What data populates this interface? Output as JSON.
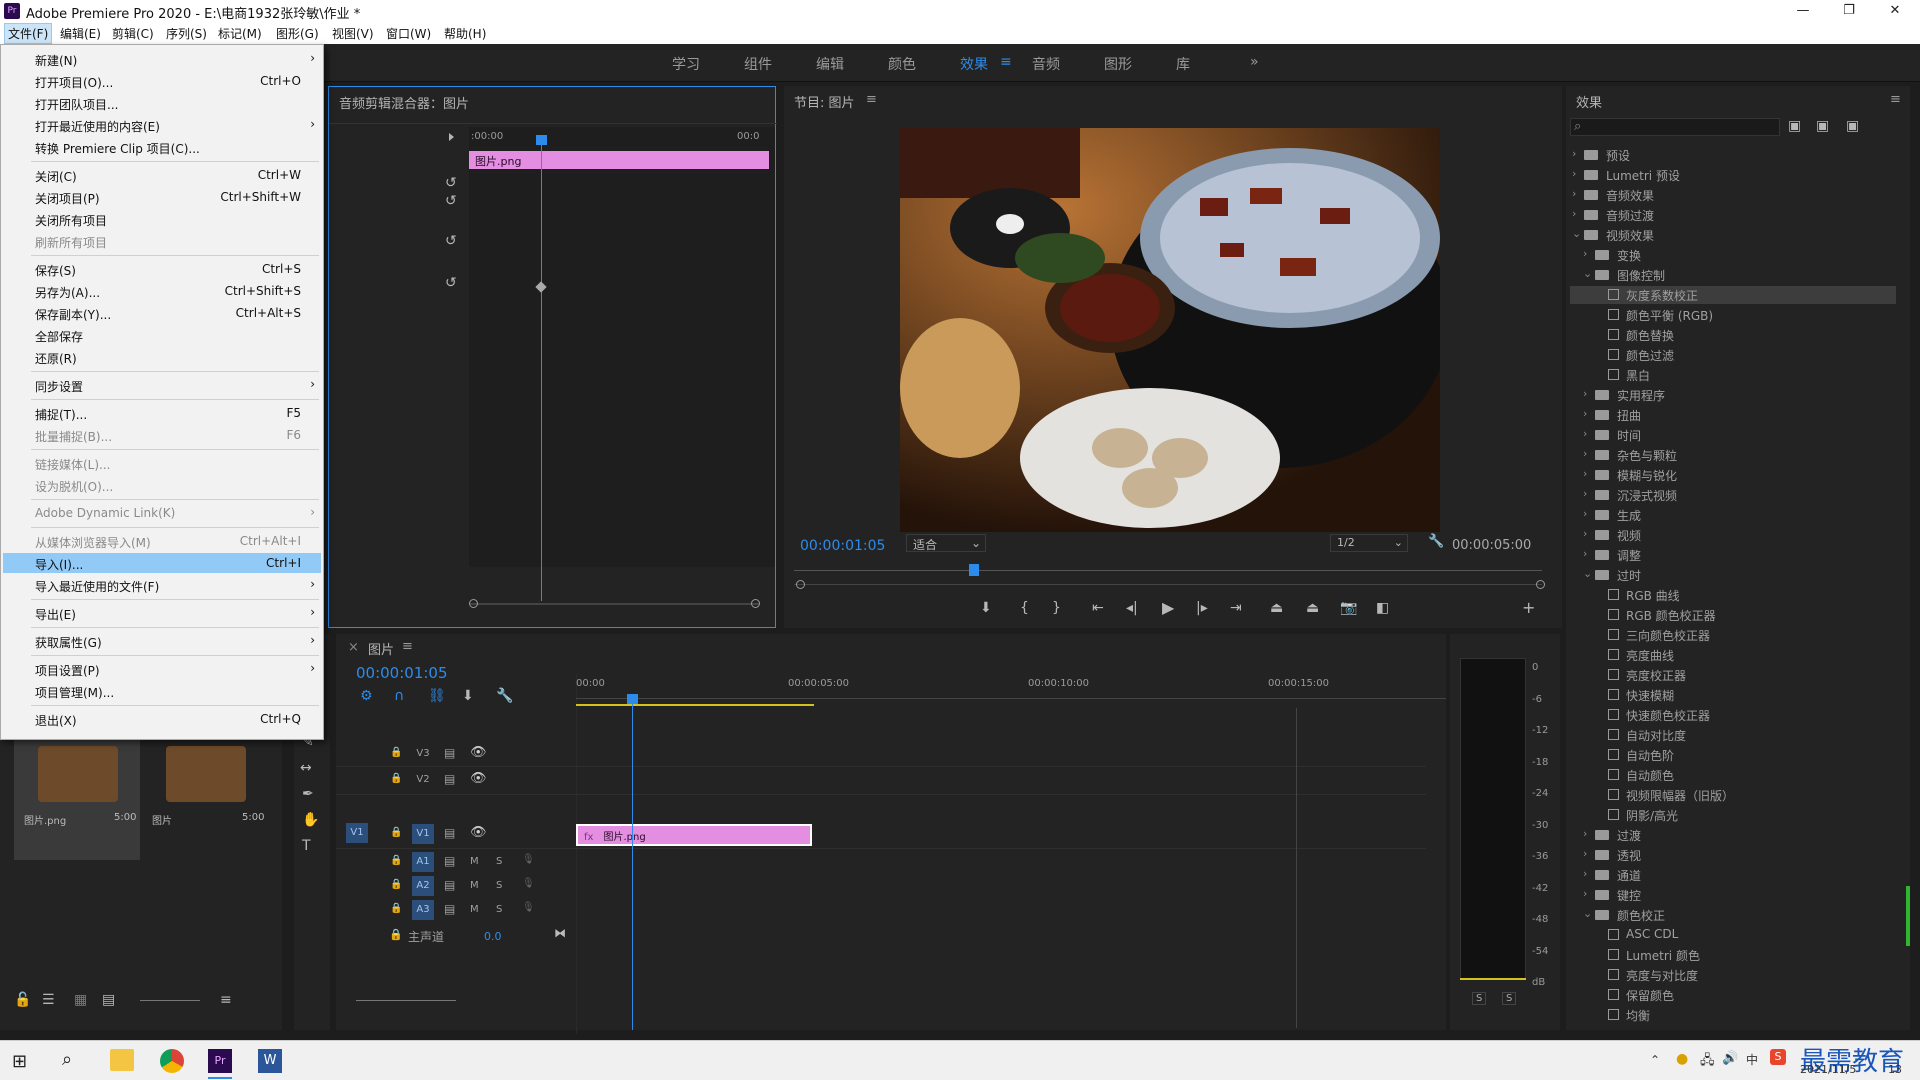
{
  "app": {
    "title": "Adobe Premiere Pro 2020 - E:\\电商1932张玲敏\\作业 *",
    "icon_label": "Pr"
  },
  "menubar": [
    "文件(F)",
    "编辑(E)",
    "剪辑(C)",
    "序列(S)",
    "标记(M)",
    "图形(G)",
    "视图(V)",
    "窗口(W)",
    "帮助(H)"
  ],
  "workspaces": [
    "学习",
    "组件",
    "编辑",
    "颜色",
    "效果",
    "音频",
    "图形",
    "库"
  ],
  "workspace_active": "效果",
  "workspace_more": "»",
  "file_menu": [
    {
      "label": "新建(N)",
      "shortcut": "",
      "arrow": true,
      "disabled": false
    },
    {
      "label": "打开项目(O)...",
      "shortcut": "Ctrl+O",
      "arrow": false,
      "disabled": false
    },
    {
      "label": "打开团队项目...",
      "shortcut": "",
      "arrow": false,
      "disabled": false
    },
    {
      "label": "打开最近使用的内容(E)",
      "shortcut": "",
      "arrow": true,
      "disabled": false
    },
    {
      "label": "转换 Premiere Clip 项目(C)...",
      "shortcut": "",
      "arrow": false,
      "disabled": false
    },
    {
      "label": "关闭(C)",
      "shortcut": "Ctrl+W",
      "arrow": false,
      "disabled": false
    },
    {
      "label": "关闭项目(P)",
      "shortcut": "Ctrl+Shift+W",
      "arrow": false,
      "disabled": false
    },
    {
      "label": "关闭所有项目",
      "shortcut": "",
      "arrow": false,
      "disabled": false
    },
    {
      "label": "刷新所有项目",
      "shortcut": "",
      "arrow": false,
      "disabled": true
    },
    {
      "label": "保存(S)",
      "shortcut": "Ctrl+S",
      "arrow": false,
      "disabled": false
    },
    {
      "label": "另存为(A)...",
      "shortcut": "Ctrl+Shift+S",
      "arrow": false,
      "disabled": false
    },
    {
      "label": "保存副本(Y)...",
      "shortcut": "Ctrl+Alt+S",
      "arrow": false,
      "disabled": false
    },
    {
      "label": "全部保存",
      "shortcut": "",
      "arrow": false,
      "disabled": false
    },
    {
      "label": "还原(R)",
      "shortcut": "",
      "arrow": false,
      "disabled": false
    },
    {
      "label": "同步设置",
      "shortcut": "",
      "arrow": true,
      "disabled": false
    },
    {
      "label": "捕捉(T)...",
      "shortcut": "F5",
      "arrow": false,
      "disabled": false
    },
    {
      "label": "批量捕捉(B)...",
      "shortcut": "F6",
      "arrow": false,
      "disabled": true
    },
    {
      "label": "链接媒体(L)...",
      "shortcut": "",
      "arrow": false,
      "disabled": true
    },
    {
      "label": "设为脱机(O)...",
      "shortcut": "",
      "arrow": false,
      "disabled": true
    },
    {
      "label": "Adobe Dynamic Link(K)",
      "shortcut": "",
      "arrow": true,
      "disabled": true
    },
    {
      "label": "从媒体浏览器导入(M)",
      "shortcut": "Ctrl+Alt+I",
      "arrow": false,
      "disabled": true
    },
    {
      "label": "导入(I)...",
      "shortcut": "Ctrl+I",
      "arrow": false,
      "disabled": false,
      "highlighted": true
    },
    {
      "label": "导入最近使用的文件(F)",
      "shortcut": "",
      "arrow": true,
      "disabled": false
    },
    {
      "label": "导出(E)",
      "shortcut": "",
      "arrow": true,
      "disabled": false
    },
    {
      "label": "获取属性(G)",
      "shortcut": "",
      "arrow": true,
      "disabled": false
    },
    {
      "label": "项目设置(P)",
      "shortcut": "",
      "arrow": true,
      "disabled": false
    },
    {
      "label": "项目管理(M)...",
      "shortcut": "",
      "arrow": false,
      "disabled": false
    },
    {
      "label": "退出(X)",
      "shortcut": "Ctrl+Q",
      "arrow": false,
      "disabled": false
    }
  ],
  "source_panel": {
    "title": "音频剪辑混合器：图片",
    "time_start": ":00:00",
    "time_end": "00:0",
    "clip": "图片.png"
  },
  "program": {
    "title": "节目: 图片",
    "timecode": "00:00:01:05",
    "fit": "适合",
    "resolution": "1/2",
    "duration": "00:00:05:00"
  },
  "timeline": {
    "tab": "图片",
    "timecode": "00:00:01:05",
    "ruler": [
      "00:00",
      "00:00:05:00",
      "00:00:10:00",
      "00:00:15:00"
    ],
    "video_tracks": [
      "V3",
      "V2",
      "V1"
    ],
    "audio_tracks": [
      "A1",
      "A2",
      "A3"
    ],
    "source_patch": "V1",
    "master": "主声道",
    "master_val": "0.0",
    "clip_v": "图片.png",
    "clip_fx": "fx",
    "m": "M",
    "s": "S"
  },
  "project": {
    "items": [
      {
        "name": "图片.png",
        "dur": "5:00"
      },
      {
        "name": "图片",
        "dur": "5:00"
      }
    ]
  },
  "meter": {
    "ticks": [
      "0",
      "-6",
      "-12",
      "-18",
      "-24",
      "-30",
      "-36",
      "-42",
      "-48",
      "-54",
      "dB"
    ],
    "solo": [
      "S",
      "S"
    ]
  },
  "effects": {
    "title": "效果",
    "tree": [
      {
        "l": "预设",
        "lvl": 0,
        "t": "f",
        "o": false
      },
      {
        "l": "Lumetri 预设",
        "lvl": 0,
        "t": "f",
        "o": false
      },
      {
        "l": "音频效果",
        "lvl": 0,
        "t": "f",
        "o": false
      },
      {
        "l": "音频过渡",
        "lvl": 0,
        "t": "f",
        "o": false
      },
      {
        "l": "视频效果",
        "lvl": 0,
        "t": "f",
        "o": true
      },
      {
        "l": "变换",
        "lvl": 1,
        "t": "f",
        "o": false
      },
      {
        "l": "图像控制",
        "lvl": 1,
        "t": "f",
        "o": true
      },
      {
        "l": "灰度系数校正",
        "lvl": 2,
        "t": "e",
        "sel": true
      },
      {
        "l": "颜色平衡 (RGB)",
        "lvl": 2,
        "t": "e"
      },
      {
        "l": "颜色替换",
        "lvl": 2,
        "t": "e"
      },
      {
        "l": "颜色过滤",
        "lvl": 2,
        "t": "e"
      },
      {
        "l": "黑白",
        "lvl": 2,
        "t": "e"
      },
      {
        "l": "实用程序",
        "lvl": 1,
        "t": "f",
        "o": false
      },
      {
        "l": "扭曲",
        "lvl": 1,
        "t": "f",
        "o": false
      },
      {
        "l": "时间",
        "lvl": 1,
        "t": "f",
        "o": false
      },
      {
        "l": "杂色与颗粒",
        "lvl": 1,
        "t": "f",
        "o": false
      },
      {
        "l": "模糊与锐化",
        "lvl": 1,
        "t": "f",
        "o": false
      },
      {
        "l": "沉浸式视频",
        "lvl": 1,
        "t": "f",
        "o": false
      },
      {
        "l": "生成",
        "lvl": 1,
        "t": "f",
        "o": false
      },
      {
        "l": "视频",
        "lvl": 1,
        "t": "f",
        "o": false
      },
      {
        "l": "调整",
        "lvl": 1,
        "t": "f",
        "o": false
      },
      {
        "l": "过时",
        "lvl": 1,
        "t": "f",
        "o": true
      },
      {
        "l": "RGB 曲线",
        "lvl": 2,
        "t": "e"
      },
      {
        "l": "RGB 颜色校正器",
        "lvl": 2,
        "t": "e"
      },
      {
        "l": "三向颜色校正器",
        "lvl": 2,
        "t": "e"
      },
      {
        "l": "亮度曲线",
        "lvl": 2,
        "t": "e"
      },
      {
        "l": "亮度校正器",
        "lvl": 2,
        "t": "e"
      },
      {
        "l": "快速模糊",
        "lvl": 2,
        "t": "e"
      },
      {
        "l": "快速颜色校正器",
        "lvl": 2,
        "t": "e"
      },
      {
        "l": "自动对比度",
        "lvl": 2,
        "t": "e"
      },
      {
        "l": "自动色阶",
        "lvl": 2,
        "t": "e"
      },
      {
        "l": "自动颜色",
        "lvl": 2,
        "t": "e"
      },
      {
        "l": "视频限幅器（旧版）",
        "lvl": 2,
        "t": "e"
      },
      {
        "l": "阴影/高光",
        "lvl": 2,
        "t": "e"
      },
      {
        "l": "过渡",
        "lvl": 1,
        "t": "f",
        "o": false
      },
      {
        "l": "透视",
        "lvl": 1,
        "t": "f",
        "o": false
      },
      {
        "l": "通道",
        "lvl": 1,
        "t": "f",
        "o": false
      },
      {
        "l": "键控",
        "lvl": 1,
        "t": "f",
        "o": false
      },
      {
        "l": "颜色校正",
        "lvl": 1,
        "t": "f",
        "o": true
      },
      {
        "l": "ASC CDL",
        "lvl": 2,
        "t": "e"
      },
      {
        "l": "Lumetri 颜色",
        "lvl": 2,
        "t": "e"
      },
      {
        "l": "亮度与对比度",
        "lvl": 2,
        "t": "e"
      },
      {
        "l": "保留颜色",
        "lvl": 2,
        "t": "e"
      },
      {
        "l": "均衡",
        "lvl": 2,
        "t": "e"
      }
    ]
  },
  "taskbar": {
    "date": "2021/11/5",
    "time": "13",
    "ime": "中",
    "watermark": "最需教育"
  },
  "colors": {
    "accent": "#2d8ceb",
    "clip": "#e38ee0",
    "yellow": "#d4c21c",
    "highlight": "#91c9f7"
  }
}
